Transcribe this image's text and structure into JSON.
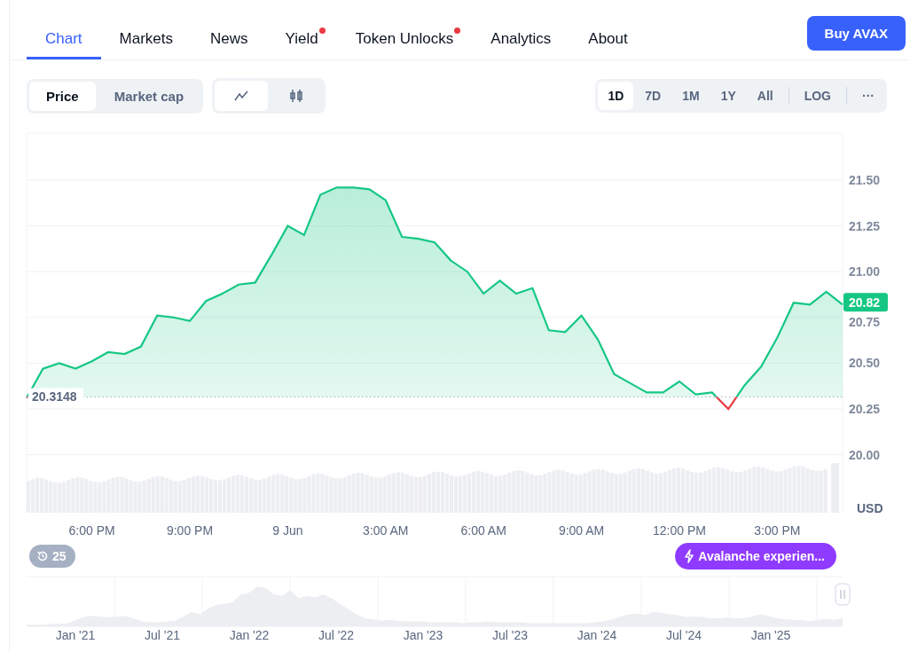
{
  "tabs": [
    {
      "label": "Chart",
      "selected": true,
      "dot": false
    },
    {
      "label": "Markets",
      "selected": false,
      "dot": false
    },
    {
      "label": "News",
      "selected": false,
      "dot": false
    },
    {
      "label": "Yield",
      "selected": false,
      "dot": true
    },
    {
      "label": "Token Unlocks",
      "selected": false,
      "dot": true
    },
    {
      "label": "Analytics",
      "selected": false,
      "dot": false
    },
    {
      "label": "About",
      "selected": false,
      "dot": false
    }
  ],
  "buy_button": "Buy AVAX",
  "metric_toggle": [
    {
      "label": "Price",
      "selected": true
    },
    {
      "label": "Market cap",
      "selected": false
    }
  ],
  "chart_style_toggle": [
    {
      "kind": "line",
      "selected": true
    },
    {
      "kind": "candles",
      "selected": false
    }
  ],
  "ranges": [
    {
      "label": "1D",
      "selected": true
    },
    {
      "label": "7D",
      "selected": false
    },
    {
      "label": "1M",
      "selected": false
    },
    {
      "label": "1Y",
      "selected": false
    },
    {
      "label": "All",
      "selected": false
    }
  ],
  "log_button": "LOG",
  "more_button": "···",
  "price_chart": {
    "chart_data": {
      "type": "area",
      "ylabel": "USD",
      "categories": [
        null,
        null,
        null,
        null,
        "6:00 PM",
        null,
        null,
        null,
        null,
        null,
        "9:00 PM",
        null,
        null,
        null,
        null,
        null,
        "9 Jun",
        null,
        null,
        null,
        null,
        null,
        "3:00 AM",
        null,
        null,
        null,
        null,
        null,
        "6:00 AM",
        null,
        null,
        null,
        null,
        null,
        "9:00 AM",
        null,
        null,
        null,
        null,
        null,
        "12:00 PM",
        null,
        null,
        null,
        null,
        null,
        "3:00 PM",
        null,
        null,
        null,
        null
      ],
      "series": [
        {
          "color": "#16c784",
          "values": [
            20.31,
            20.47,
            20.5,
            20.47,
            20.51,
            20.56,
            20.55,
            20.59,
            20.76,
            20.75,
            20.73,
            20.84,
            20.88,
            20.93,
            20.94,
            21.09,
            21.25,
            21.2,
            21.42,
            21.46,
            21.46,
            21.45,
            21.39,
            21.19,
            21.18,
            21.16,
            21.06,
            21.0,
            20.88,
            20.95,
            20.88,
            20.91,
            20.68,
            20.67,
            20.76,
            20.63,
            20.44,
            20.39,
            20.34,
            20.34,
            20.4,
            20.33,
            20.34,
            20.25,
            20.38,
            20.48,
            20.64,
            20.83,
            20.82,
            20.89,
            20.82
          ]
        }
      ],
      "ylim": [
        19.683,
        21.757
      ],
      "grid": true,
      "ref_lines": [
        {
          "axis": "y",
          "value": 20.3148,
          "label": "20.3148"
        }
      ],
      "yticks": [
        {
          "value": 20.0,
          "label": "20.00"
        },
        {
          "value": 20.25,
          "label": "20.25"
        },
        {
          "value": 20.5,
          "label": "20.50"
        },
        {
          "value": 20.75,
          "label": "20.75"
        },
        {
          "value": 21.0,
          "label": "21.00"
        },
        {
          "value": 21.25,
          "label": "21.25"
        },
        {
          "value": 21.5,
          "label": "21.50"
        }
      ]
    },
    "current_price": "20.82"
  },
  "history_badge": "25",
  "promo_pill": "Avalanche experien...",
  "navigator": {
    "labels": [
      "Jan '21",
      "Jul '21",
      "Jan '22",
      "Jul '22",
      "Jan '23",
      "Jul '23",
      "Jan '24",
      "Jul '24",
      "Jan '25"
    ]
  }
}
